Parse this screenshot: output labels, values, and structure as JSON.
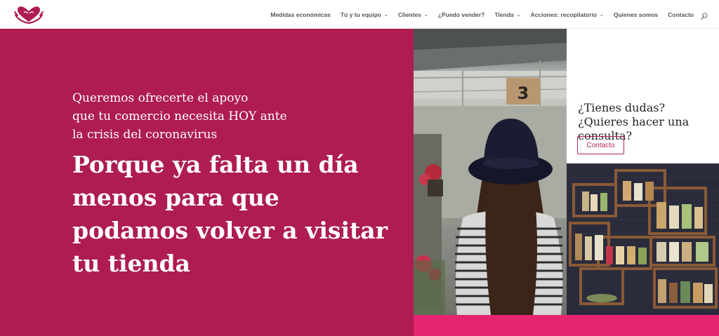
{
  "nav": {
    "items": [
      {
        "label": "Medidas económicas",
        "dropdown": false
      },
      {
        "label": "Tú y tu equipo",
        "dropdown": true
      },
      {
        "label": "Clientes",
        "dropdown": true
      },
      {
        "label": "¿Puedo vender?",
        "dropdown": false
      },
      {
        "label": "Tienda",
        "dropdown": true
      },
      {
        "label": "Acciones: recopilatorio",
        "dropdown": true
      },
      {
        "label": "Quienes somos",
        "dropdown": false
      },
      {
        "label": "Contacto",
        "dropdown": false
      }
    ],
    "search_icon": "search-icon"
  },
  "hero": {
    "subtitle_lines": [
      "Queremos ofrecerte el apoyo",
      "que tu comercio necesita HOY ante",
      "la crisis del coronavirus"
    ],
    "title_lines": [
      "Porque ya falta un día",
      "menos para que",
      "podamos volver a visitar",
      "tu tienda"
    ]
  },
  "photo1": {
    "sign_text": "3"
  },
  "cta": {
    "text": "¿Tienes dudas? ¿Quieres hacer una consulta?",
    "button_label": "Contacto"
  },
  "colors": {
    "hero_bg": "#ae1c52",
    "accent_pink": "#e6246f",
    "button_border": "#b5245a"
  }
}
